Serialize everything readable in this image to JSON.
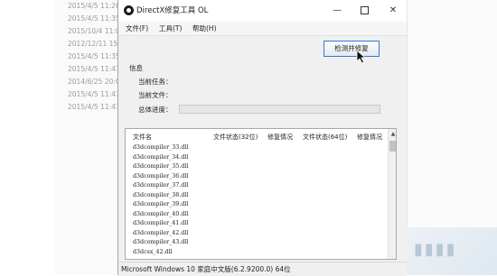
{
  "background_dates": [
    "2015/4/5 11:26",
    "2015/4/5 11:35",
    "2015/10/4 11:05",
    "2012/12/11 15:",
    "2015/4/5 11:35",
    "2015/4/5 11:41",
    "2014/6/25 20:0",
    "2015/4/5 11:47",
    "2015/4/5 11:47"
  ],
  "window": {
    "title": "DirectX修复工具 OL",
    "minimize_glyph": "—",
    "close_glyph": "✕"
  },
  "menu": {
    "file": "文件(F)",
    "tools": "工具(T)",
    "help": "帮助(H)"
  },
  "check_button": "检测并修复",
  "info": {
    "heading": "信息",
    "current_task": "当前任务：",
    "current_file": "当前文件：",
    "total_progress": "总体进度：",
    "progress": 0
  },
  "table": {
    "headers": [
      "文件名",
      "文件状态(32位)",
      "修复情况",
      "文件状态(64位)",
      "修复情况"
    ],
    "rows": [
      "d3dcompiler_33.dll",
      "d3dcompiler_34.dll",
      "d3dcompiler_35.dll",
      "d3dcompiler_36.dll",
      "d3dcompiler_37.dll",
      "d3dcompiler_38.dll",
      "d3dcompiler_39.dll",
      "d3dcompiler_40.dll",
      "d3dcompiler_41.dll",
      "d3dcompiler_42.dll",
      "d3dcompiler_43.dll",
      "d3dcsx_42.dll"
    ],
    "scroll_up_glyph": "▲"
  },
  "status": "Microsoft Windows 10 家庭中文版(6.2.9200.0) 64位",
  "colors": {
    "accent": "#2f7bd8",
    "progress": "#3ea83e"
  },
  "icons": [
    "app-icon",
    "cursor-icon"
  ]
}
